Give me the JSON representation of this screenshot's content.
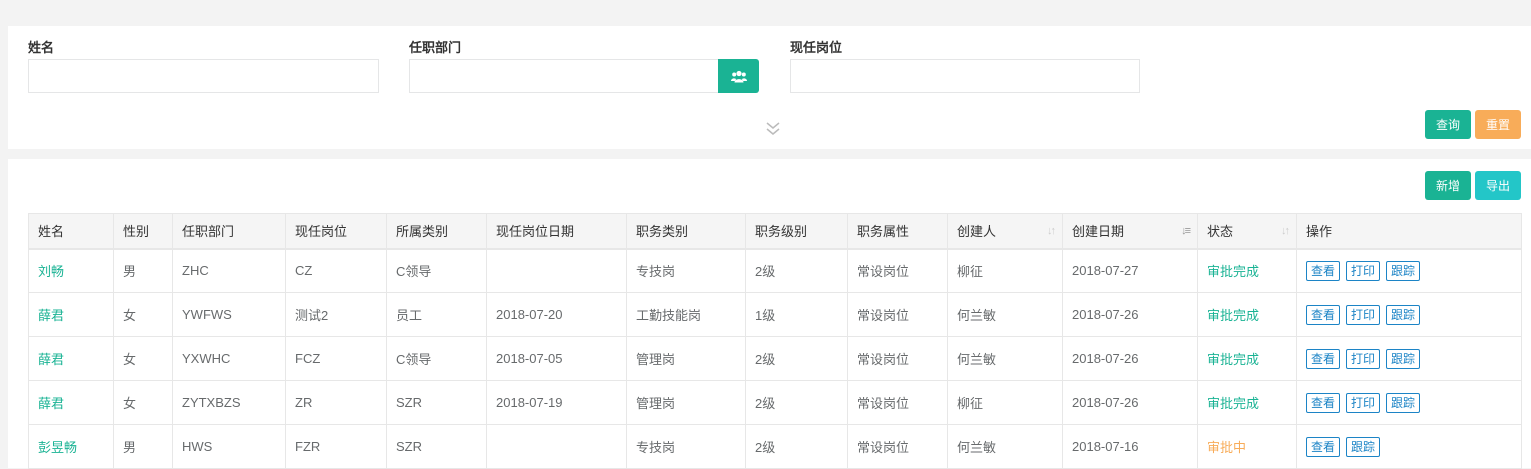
{
  "search": {
    "name_label": "姓名",
    "name_value": "",
    "dept_label": "任职部门",
    "dept_value": "",
    "dept_picker_icon": "group-icon",
    "post_label": "现任岗位",
    "post_value": "",
    "collapse_icon": "double-chevron-down-icon",
    "query_label": "查询",
    "reset_label": "重置"
  },
  "toolbar": {
    "add_label": "新增",
    "export_label": "导出"
  },
  "table": {
    "headers": [
      "姓名",
      "性别",
      "任职部门",
      "现任岗位",
      "所属类别",
      "现任岗位日期",
      "职务类别",
      "职务级别",
      "职务属性",
      "创建人",
      "创建日期",
      "状态",
      "操作"
    ],
    "rows": [
      {
        "name": "刘畅",
        "gender": "男",
        "dept": "ZHC",
        "post": "CZ",
        "category": "C领导",
        "post_date": "",
        "duty_type": "专技岗",
        "duty_level": "2级",
        "duty_attr": "常设岗位",
        "creator": "柳征",
        "created": "2018-07-27",
        "status": "审批完成",
        "actions": [
          "查看",
          "打印",
          "跟踪"
        ]
      },
      {
        "name": "薛君",
        "gender": "女",
        "dept": "YWFWS",
        "post": "测试2",
        "category": "员工",
        "post_date": "2018-07-20",
        "duty_type": "工勤技能岗",
        "duty_level": "1级",
        "duty_attr": "常设岗位",
        "creator": "何兰敏",
        "created": "2018-07-26",
        "status": "审批完成",
        "actions": [
          "查看",
          "打印",
          "跟踪"
        ]
      },
      {
        "name": "薛君",
        "gender": "女",
        "dept": "YXWHC",
        "post": "FCZ",
        "category": "C领导",
        "post_date": "2018-07-05",
        "duty_type": "管理岗",
        "duty_level": "2级",
        "duty_attr": "常设岗位",
        "creator": "何兰敏",
        "created": "2018-07-26",
        "status": "审批完成",
        "actions": [
          "查看",
          "打印",
          "跟踪"
        ]
      },
      {
        "name": "薛君",
        "gender": "女",
        "dept": "ZYTXBZS",
        "post": "ZR",
        "category": "SZR",
        "post_date": "2018-07-19",
        "duty_type": "管理岗",
        "duty_level": "2级",
        "duty_attr": "常设岗位",
        "creator": "柳征",
        "created": "2018-07-26",
        "status": "审批完成",
        "actions": [
          "查看",
          "打印",
          "跟踪"
        ]
      },
      {
        "name": "彭昱畅",
        "gender": "男",
        "dept": "HWS",
        "post": "FZR",
        "category": "SZR",
        "post_date": "",
        "duty_type": "专技岗",
        "duty_level": "2级",
        "duty_attr": "常设岗位",
        "creator": "何兰敏",
        "created": "2018-07-16",
        "status": "审批中",
        "actions": [
          "查看",
          "跟踪"
        ]
      }
    ]
  }
}
